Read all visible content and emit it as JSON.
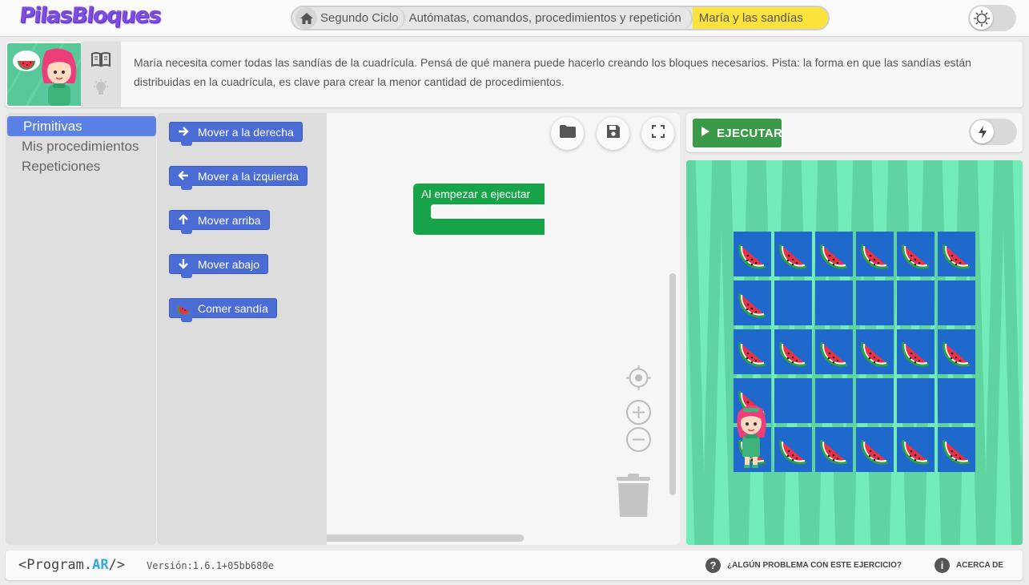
{
  "app": {
    "logo_text": "PilasBloques"
  },
  "breadcrumb": {
    "items": [
      {
        "label": "Segundo Ciclo"
      },
      {
        "label": "Autómatas, comandos, procedimientos y repetición"
      },
      {
        "label": "María y las sandías"
      }
    ]
  },
  "description": {
    "text": "María necesita comer todas las sandías de la cuadrícula. Pensá de qué manera puede hacerlo creando los bloques necesarios. Pista: la forma en que las sandías están distribuidas en la cuadrícula, es clave para crear la menor cantidad de procedimientos."
  },
  "categories": [
    {
      "label": "Primitivas",
      "active": true
    },
    {
      "label": "Mis procedimientos",
      "active": false
    },
    {
      "label": "Repeticiones",
      "active": false
    }
  ],
  "blocks": [
    {
      "label": "Mover a la derecha",
      "icon": "arrow-right-icon"
    },
    {
      "label": "Mover a la izquierda",
      "icon": "arrow-left-icon"
    },
    {
      "label": "Mover arriba",
      "icon": "arrow-up-icon"
    },
    {
      "label": "Mover abajo",
      "icon": "arrow-down-icon"
    },
    {
      "label": "Comer sandía",
      "icon": "watermelon-icon"
    }
  ],
  "workspace": {
    "start_block_label": "Al empezar a ejecutar"
  },
  "run": {
    "label": "EJECUTAR"
  },
  "stage": {
    "rows": 5,
    "cols": 6,
    "watermelon_rows": [
      [
        1,
        1,
        1,
        1,
        1,
        1
      ],
      [
        1,
        0,
        0,
        0,
        0,
        0
      ],
      [
        1,
        1,
        1,
        1,
        1,
        1
      ],
      [
        1,
        0,
        0,
        0,
        0,
        0
      ],
      [
        1,
        1,
        1,
        1,
        1,
        1
      ]
    ],
    "character_cell": [
      4,
      0
    ]
  },
  "footer": {
    "logo": {
      "prefix": "<Program.",
      "accent": "AR",
      "suffix": "/>"
    },
    "version": "Versión:1.6.1+05bb680e",
    "problem_link": "¿ALGÚN PROBLEMA CON ESTE EJERCICIO?",
    "about_link": "ACERCA DE"
  },
  "colors": {
    "accent": "#5b80e6",
    "block": "#4a6cd4",
    "start_block": "#17a348",
    "run": "#3b9a47",
    "breadcrumb_active": "#fbe23c",
    "stage_cell": "#1f68cc"
  }
}
